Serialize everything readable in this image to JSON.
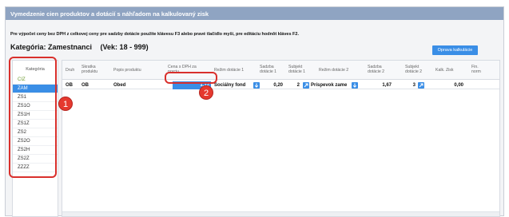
{
  "window": {
    "title": "Vymedzenie cien produktov a dotácií s náhľadom na kalkulovaný zisk"
  },
  "hint": "Pre výpočet ceny bez DPH z celkovej ceny pre sadzby dotácie použite klávesu F3 alebo pravé tlačidlo myši, pre editáciu hodnôt kláves F2.",
  "heading": {
    "category_label": "Kategória: Zamestnanci",
    "age_label": "(Vek: 18 - 999)"
  },
  "buttons": {
    "fix_calc": "Oprava kalkulácie"
  },
  "category_panel": {
    "header": "Kategória",
    "items": [
      "CIZ",
      "ZAM",
      "ZS1",
      "ZS1O",
      "ZS1H",
      "ZS1Z",
      "ZS2",
      "ZS2O",
      "ZS2H",
      "ZS2Z",
      "ZZZZ"
    ],
    "selected_index": 1
  },
  "grid": {
    "columns": [
      "Druh",
      "Skratka produktu",
      "Popis produktu",
      "Cena s DPH za porciu",
      "Režim dotácie 1",
      "Sadzba dotácie 1",
      "Subjekt dotácie 1",
      "Režim dotácie 2",
      "Sadzba dotácie 2",
      "Subjekt dotácie 2",
      "Kalk. Zisk",
      "Fin. norm"
    ],
    "rows": [
      {
        "druh": "OB",
        "skratka": "OB",
        "popis": "Obed",
        "cena": "1,12",
        "rezim1": "Sociálny fond",
        "sadzba1": "0,20",
        "subjekt1": "2",
        "rezim2": "Príspevok zame",
        "sadzba2": "1,67",
        "subjekt2": "3",
        "zisk": "0,00"
      }
    ]
  },
  "annotations": {
    "badge1": "1",
    "badge2": "2"
  },
  "colors": {
    "titlebar": "#8fa4c2",
    "accent": "#3a8ee6",
    "callout": "#d9302c"
  }
}
